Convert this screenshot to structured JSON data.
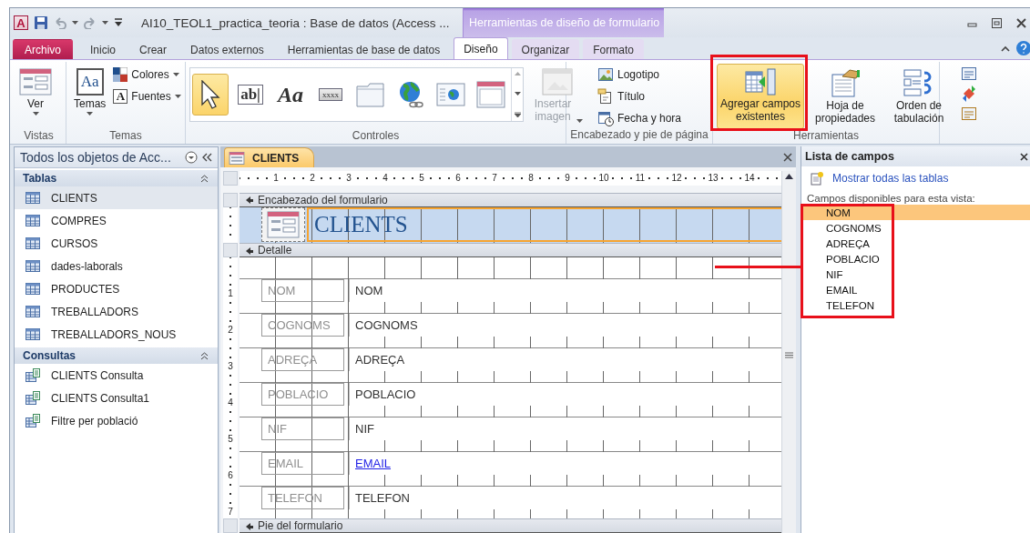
{
  "title_bar": {
    "app_glyph": "A",
    "title": "AI10_TEOL1_practica_teoria : Base de datos (Access ...",
    "context_label": "Herramientas de diseño de formulario"
  },
  "ribbon_tabs": [
    {
      "label": "Archivo",
      "kind": "file",
      "selected": false
    },
    {
      "label": "Inicio",
      "kind": "main",
      "selected": false
    },
    {
      "label": "Crear",
      "kind": "main",
      "selected": false
    },
    {
      "label": "Datos externos",
      "kind": "main",
      "selected": false
    },
    {
      "label": "Herramientas de base de datos",
      "kind": "main",
      "selected": false
    },
    {
      "label": "Diseño",
      "kind": "context",
      "selected": true
    },
    {
      "label": "Organizar",
      "kind": "context",
      "selected": false
    },
    {
      "label": "Formato",
      "kind": "context",
      "selected": false
    }
  ],
  "ribbon_groups": [
    {
      "kind": "views",
      "label": "Vistas",
      "buttons": [
        {
          "label": "Ver"
        }
      ]
    },
    {
      "kind": "themes",
      "label": "Temas",
      "buttons": [
        {
          "label": "Temas",
          "glyph": "Aa"
        },
        {
          "label": "Colores"
        },
        {
          "label": "Fuentes",
          "glyph": "A"
        }
      ]
    },
    {
      "kind": "controls",
      "label": "Controles",
      "tools": [
        {
          "selected": true
        },
        {
          "glyph": "ab|",
          "selected": false
        },
        {
          "glyph": "Aa",
          "selected": false
        },
        {
          "glyph": "xxxx",
          "selected": false
        },
        {
          "selected": false
        },
        {
          "selected": false
        },
        {
          "selected": false
        },
        {
          "selected": false
        }
      ],
      "buttons": [
        {
          "label": "Insertar imagen",
          "disabled": true
        }
      ]
    },
    {
      "kind": "header_footer",
      "label": "Encabezado y pie de página",
      "buttons": [
        {
          "label": "Logotipo"
        },
        {
          "label": "Título"
        },
        {
          "label": "Fecha y hora"
        }
      ]
    },
    {
      "kind": "tools",
      "label": "Herramientas",
      "buttons": [
        {
          "label": "Agregar campos existentes",
          "selected": true
        },
        {
          "label": "Hoja de propiedades",
          "selected": false
        },
        {
          "label": "Orden de tabulación",
          "selected": false
        }
      ]
    }
  ],
  "navigation": {
    "title": "Todos los objetos de Acc...",
    "sections": [
      {
        "kind": "tables",
        "label": "Tablas",
        "expanded": true,
        "items": [
          {
            "label": "CLIENTS",
            "selected": true
          },
          {
            "label": "COMPRES",
            "selected": false
          },
          {
            "label": "CURSOS",
            "selected": false
          },
          {
            "label": "dades-laborals",
            "selected": false
          },
          {
            "label": "PRODUCTES",
            "selected": false
          },
          {
            "label": "TREBALLADORS",
            "selected": false
          },
          {
            "label": "TREBALLADORS_NOUS",
            "selected": false
          }
        ]
      },
      {
        "kind": "queries",
        "label": "Consultas",
        "expanded": true,
        "items": [
          {
            "label": "CLIENTS Consulta",
            "selected": false
          },
          {
            "label": "CLIENTS Consulta1",
            "selected": false
          },
          {
            "label": "Filtre per població",
            "selected": false
          }
        ]
      }
    ]
  },
  "document": {
    "tab": "CLIENTS",
    "ruler_marks": [
      "1",
      "2",
      "3",
      "4",
      "5",
      "6",
      "7",
      "8",
      "9",
      "10",
      "11",
      "12",
      "13",
      "14"
    ],
    "side_ruler_marks": [
      "1",
      "2",
      "3",
      "4",
      "5",
      "6",
      "7"
    ],
    "header_band": "Encabezado del formulario",
    "form_title": "CLIENTS",
    "title_selected": true,
    "detail_band": "Detalle",
    "footer_band": "Pie del formulario",
    "fields": [
      {
        "label": "NOM",
        "control": "NOM",
        "kind": "text"
      },
      {
        "label": "COGNOMS",
        "control": "COGNOMS",
        "kind": "text"
      },
      {
        "label": "ADREÇA",
        "control": "ADREÇA",
        "kind": "text"
      },
      {
        "label": "POBLACIO",
        "control": "POBLACIO",
        "kind": "text"
      },
      {
        "label": "NIF",
        "control": "NIF",
        "kind": "text"
      },
      {
        "label": "EMAIL",
        "control": "EMAIL",
        "kind": "hyperlink"
      },
      {
        "label": "TELEFON",
        "control": "TELEFON",
        "kind": "text"
      }
    ]
  },
  "field_list": {
    "title": "Lista de campos",
    "show_all_link": "Mostrar todas las tablas",
    "caption": "Campos disponibles para esta vista:",
    "fields": [
      {
        "name": "NOM",
        "selected": true
      },
      {
        "name": "COGNOMS",
        "selected": false
      },
      {
        "name": "ADREÇA",
        "selected": false
      },
      {
        "name": "POBLACIO",
        "selected": false
      },
      {
        "name": "NIF",
        "selected": false
      },
      {
        "name": "EMAIL",
        "selected": false
      },
      {
        "name": "TELEFON",
        "selected": false
      }
    ]
  }
}
